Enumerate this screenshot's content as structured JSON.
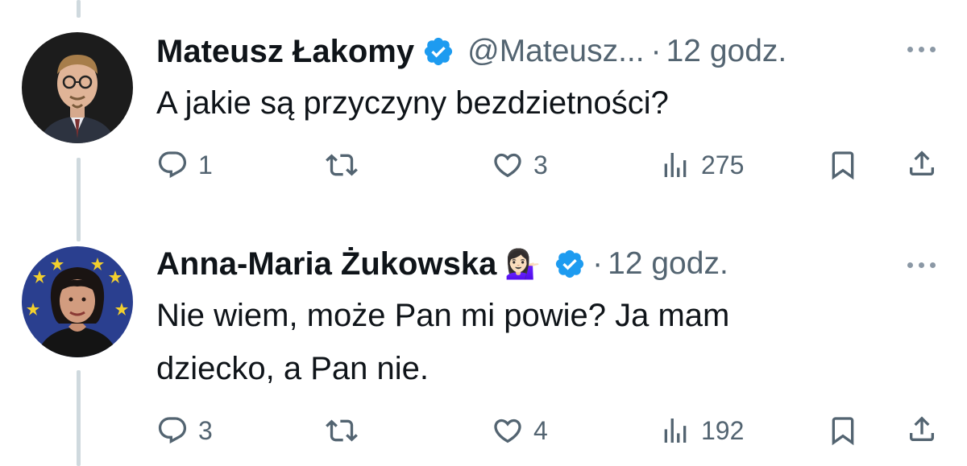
{
  "tweets": [
    {
      "name": "Mateusz Łakomy",
      "handle": "@Mateusz...",
      "separator": "·",
      "time": "12 godz.",
      "emoji": "",
      "text_lines": [
        "A jakie są przyczyny bezdzietności?"
      ],
      "replies": "1",
      "retweets": "",
      "likes": "3",
      "views": "275"
    },
    {
      "name": "Anna-Maria Żukowska",
      "handle": "",
      "separator": "·",
      "time": "12 godz.",
      "emoji": "💁🏻‍♀️",
      "text_lines": [
        "Nie wiem, może Pan mi powie? Ja mam",
        "dziecko, a Pan nie."
      ],
      "replies": "3",
      "retweets": "",
      "likes": "4",
      "views": "192"
    }
  ],
  "icons": {
    "reply": "reply-icon",
    "retweet": "retweet-icon",
    "like": "heart-icon",
    "views": "views-icon",
    "bookmark": "bookmark-icon",
    "share": "share-icon",
    "verified": "verified-badge-icon",
    "more": "more-icon"
  },
  "colors": {
    "verified": "#1d9bf0",
    "secondary_text": "#536471",
    "thread_line": "#cfd9de"
  }
}
